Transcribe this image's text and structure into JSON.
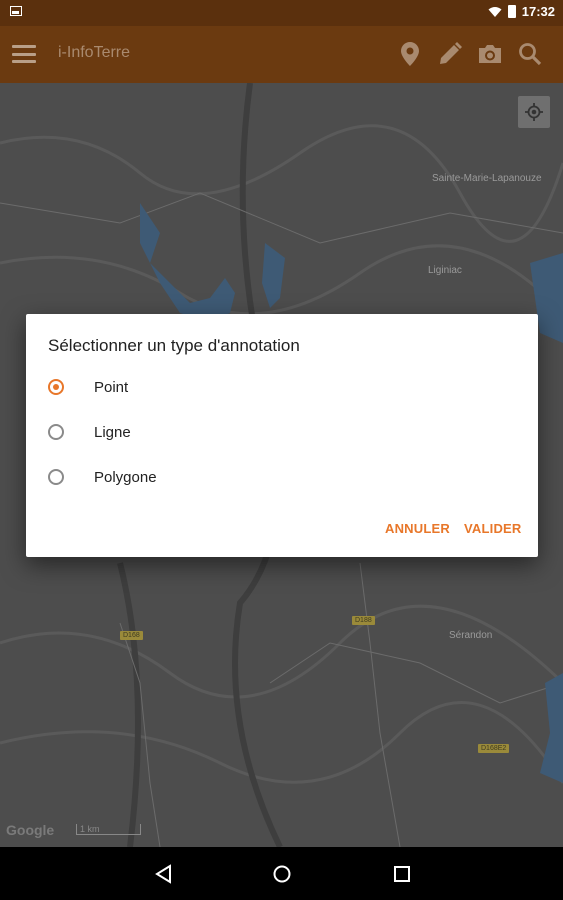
{
  "status_bar": {
    "time": "17:32"
  },
  "app_bar": {
    "title": "i-InfoTerre",
    "actions": [
      "location-pin-icon",
      "pencil-icon",
      "camera-icon",
      "search-icon"
    ]
  },
  "map": {
    "places": [
      "Sainte-Marie-Lapanouze",
      "Liginiac",
      "Sérandon"
    ],
    "road_labels": [
      "D168",
      "D188",
      "D168E2"
    ],
    "attribution": "Google",
    "scale": "1 km"
  },
  "dialog": {
    "title": "Sélectionner un type d'annotation",
    "options": [
      {
        "label": "Point",
        "selected": true
      },
      {
        "label": "Ligne",
        "selected": false
      },
      {
        "label": "Polygone",
        "selected": false
      }
    ],
    "cancel_label": "ANNULER",
    "confirm_label": "VALIDER"
  },
  "colors": {
    "accent": "#e8772a",
    "app_bar": "#6b3a10",
    "status_bar": "#5b300d"
  }
}
